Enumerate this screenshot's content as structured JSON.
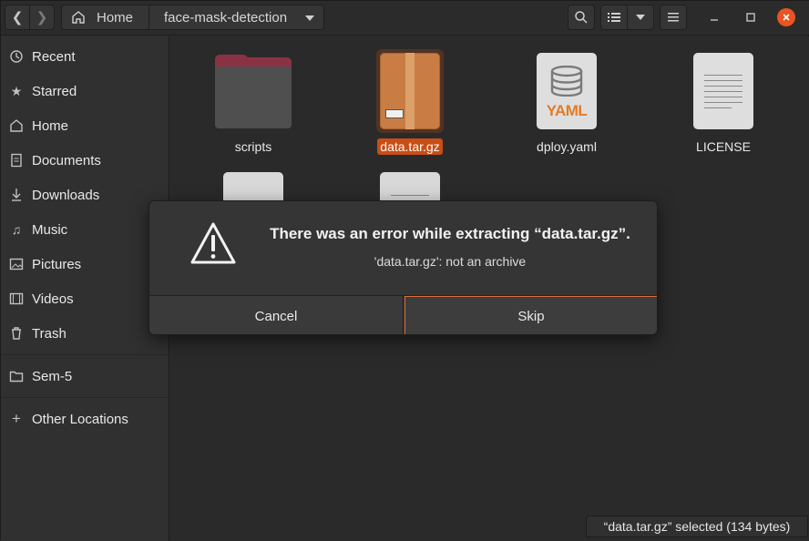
{
  "headerbar": {
    "back_icon": "chevron-left-icon",
    "forward_icon": "chevron-right-icon",
    "breadcrumb_home": "Home",
    "breadcrumb_current": "face-mask-detection"
  },
  "sidebar": {
    "items": [
      {
        "label": "Recent",
        "icon": "clock-icon"
      },
      {
        "label": "Starred",
        "icon": "star-icon"
      },
      {
        "label": "Home",
        "icon": "home-icon"
      },
      {
        "label": "Documents",
        "icon": "document-icon"
      },
      {
        "label": "Downloads",
        "icon": "download-icon"
      },
      {
        "label": "Music",
        "icon": "music-icon"
      },
      {
        "label": "Pictures",
        "icon": "picture-icon"
      },
      {
        "label": "Videos",
        "icon": "video-icon"
      },
      {
        "label": "Trash",
        "icon": "trash-icon"
      },
      {
        "label": "Sem-5",
        "icon": "folder-icon"
      },
      {
        "label": "Other Locations",
        "icon": "plus-icon"
      }
    ]
  },
  "files": [
    {
      "name": "scripts",
      "type": "folder"
    },
    {
      "name": "data.tar.gz",
      "type": "archive",
      "selected": true
    },
    {
      "name": "dploy.yaml",
      "type": "yaml",
      "badge": "YAML"
    },
    {
      "name": "LICENSE",
      "type": "text"
    }
  ],
  "dialog": {
    "title": "There was an error while extracting “data.tar.gz”.",
    "message": "'data.tar.gz': not an archive",
    "cancel_label": "Cancel",
    "skip_label": "Skip"
  },
  "status": {
    "text": "“data.tar.gz” selected  (134 bytes)"
  },
  "colors": {
    "accent": "#e95420",
    "selection": "#c84e15"
  }
}
